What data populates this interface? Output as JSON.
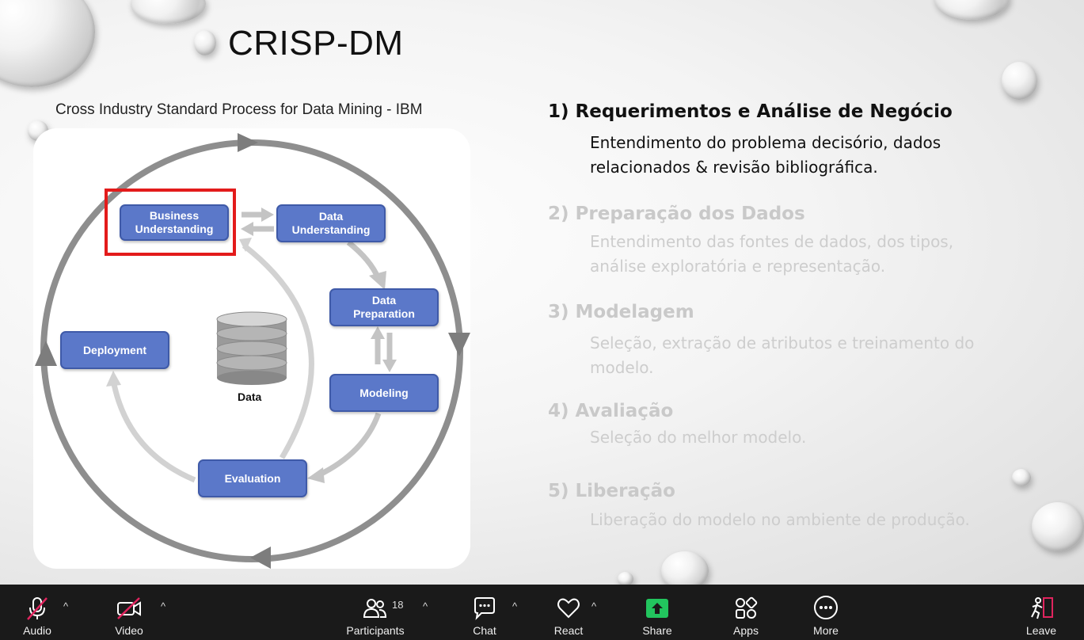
{
  "slide": {
    "title": "CRISP-DM",
    "subtitle": "Cross Industry Standard Process for Data Mining - IBM"
  },
  "diagram": {
    "nodes": {
      "business": "Business\nUnderstanding",
      "data_understanding": "Data\nUnderstanding",
      "data_preparation": "Data\nPreparation",
      "modeling": "Modeling",
      "evaluation": "Evaluation",
      "deployment": "Deployment",
      "data_store": "Data"
    },
    "highlighted_node": "Business Understanding"
  },
  "steps": [
    {
      "heading": "1) Requerimentos e Análise de Negócio",
      "desc": "Entendimento do problema decisório, dados relacionados & revisão bibliográfica.",
      "active": true
    },
    {
      "heading": "2) Preparação dos Dados",
      "desc": "Entendimento das fontes de dados, dos tipos, análise exploratória e representação.",
      "active": false
    },
    {
      "heading": "3) Modelagem",
      "desc": "Seleção, extração de atributos e treinamento do modelo.",
      "active": false
    },
    {
      "heading": "4) Avaliação",
      "desc": "Seleção do melhor modelo.",
      "active": false
    },
    {
      "heading": "5) Liberação",
      "desc": "Liberação do modelo no ambiente de produção.",
      "active": false
    }
  ],
  "toolbar": {
    "audio": "Audio",
    "video": "Video",
    "participants": "Participants",
    "participants_count": "18",
    "chat": "Chat",
    "react": "React",
    "share": "Share",
    "apps": "Apps",
    "more": "More",
    "leave": "Leave",
    "share_color": "#22c55e",
    "muted_color": "#e0245e"
  }
}
